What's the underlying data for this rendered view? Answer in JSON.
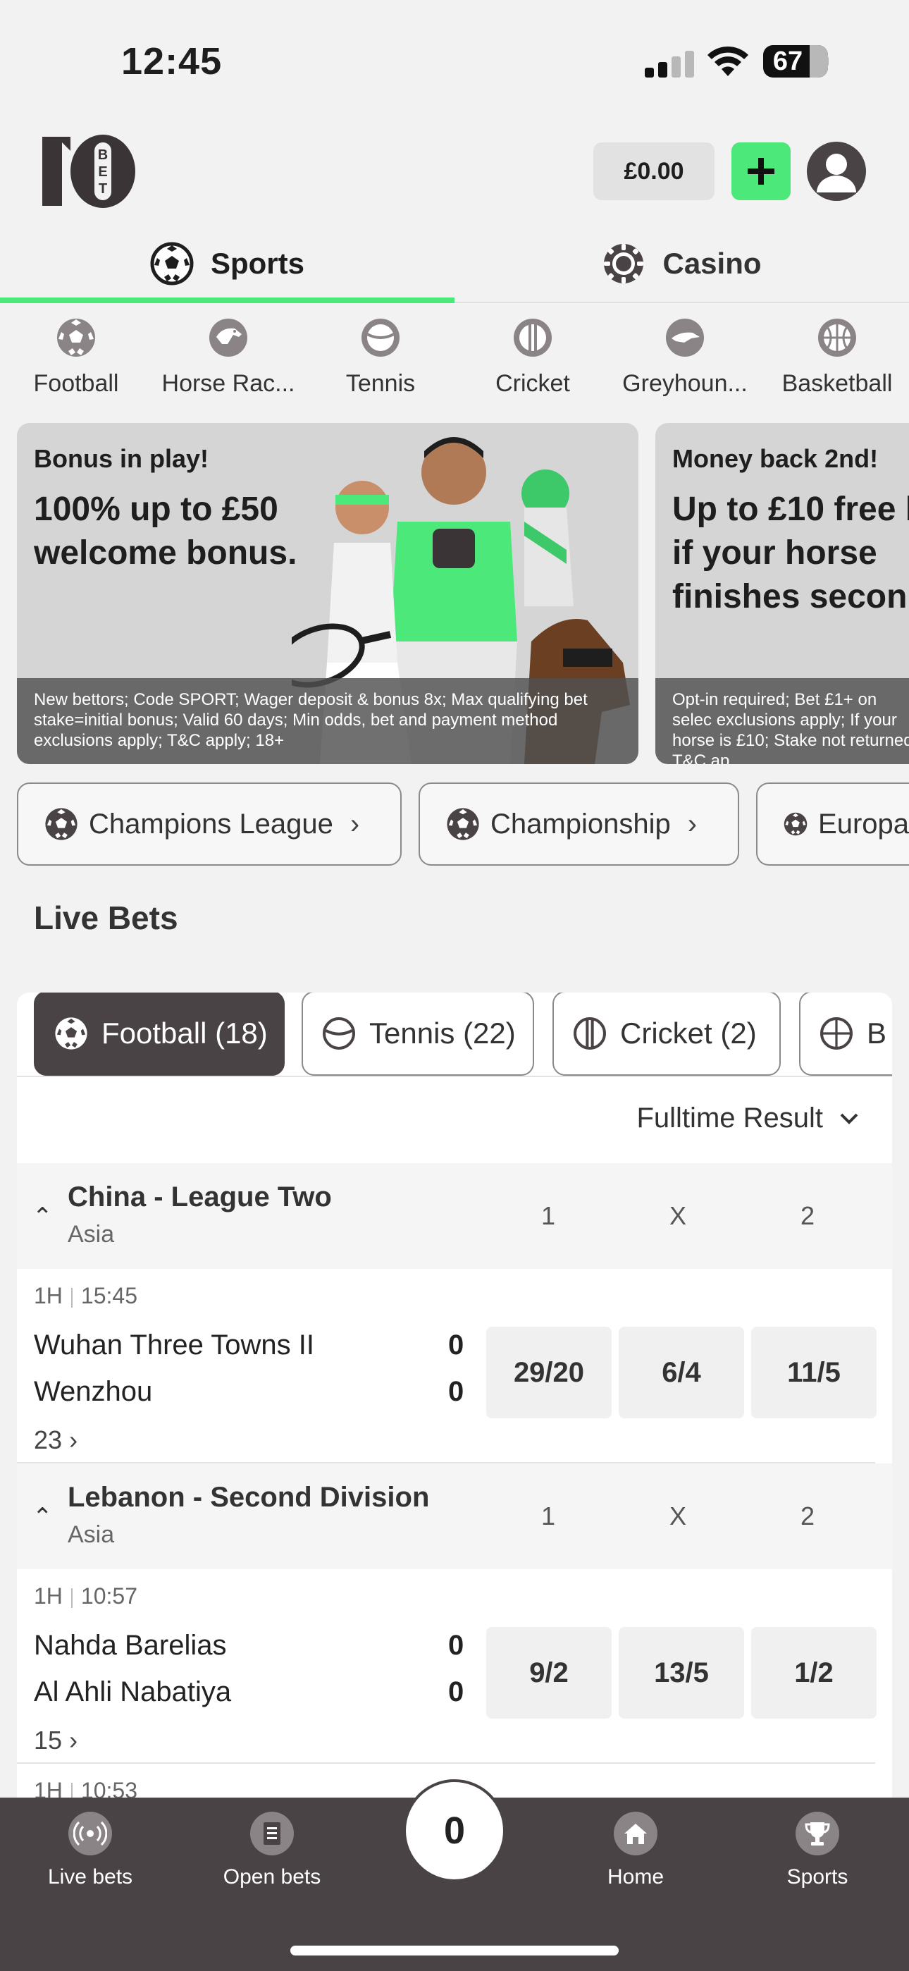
{
  "status_bar": {
    "time": "12:45",
    "battery": "67"
  },
  "header": {
    "balance": "£0.00"
  },
  "top_tabs": [
    {
      "label": "Sports",
      "icon": "football-icon"
    },
    {
      "label": "Casino",
      "icon": "casino-chip-icon"
    }
  ],
  "sports": [
    {
      "label": "Football",
      "icon": "football-icon"
    },
    {
      "label": "Horse Rac...",
      "icon": "horse-racing-icon"
    },
    {
      "label": "Tennis",
      "icon": "tennis-ball-icon"
    },
    {
      "label": "Cricket",
      "icon": "cricket-ball-icon"
    },
    {
      "label": "Greyhoun...",
      "icon": "greyhound-icon"
    },
    {
      "label": "Basketball",
      "icon": "basketball-icon"
    }
  ],
  "promos": [
    {
      "kicker": "Bonus in play!",
      "headline": "100% up to £50\nwelcome bonus.",
      "terms": "New bettors; Code SPORT; Wager deposit & bonus 8x; Max qualifying bet stake=initial bonus; Valid 60 days; Min odds, bet and payment method exclusions apply; T&C apply; 18+"
    },
    {
      "kicker": "Money back 2nd!",
      "headline": "Up to £10 free b\nif your horse\nfinishes secon",
      "terms": "Opt-in required; Bet £1+ on selec exclusions apply; If your horse is £10; Stake not returned; T&C ap"
    }
  ],
  "league_chips": [
    "Champions League",
    "Championship",
    "Europa"
  ],
  "live_bets": {
    "title": "Live Bets",
    "filters": [
      "Football (18)",
      "Tennis (22)",
      "Cricket (2)",
      "B"
    ],
    "market": "Fulltime Result",
    "columns": [
      "1",
      "X",
      "2"
    ],
    "leagues": [
      {
        "name": "China - League Two",
        "region": "Asia",
        "event": {
          "period": "1H",
          "clock": "15:45",
          "home": "Wuhan Three Towns II",
          "away": "Wenzhou",
          "home_score": "0",
          "away_score": "0",
          "odds": [
            "29/20",
            "6/4",
            "11/5"
          ],
          "more": "23"
        }
      },
      {
        "name": "Lebanon - Second Division",
        "region": "Asia",
        "event": {
          "period": "1H",
          "clock": "10:57",
          "home": "Nahda Barelias",
          "away": "Al Ahli Nabatiya",
          "home_score": "0",
          "away_score": "0",
          "odds": [
            "9/2",
            "13/5",
            "1/2"
          ],
          "more": "15"
        }
      }
    ],
    "next_event": {
      "period": "1H",
      "clock": "10:53"
    }
  },
  "bottom_nav": {
    "items": [
      {
        "label": "Live bets",
        "icon": "live-broadcast-icon"
      },
      {
        "label": "Open bets",
        "icon": "receipt-icon"
      },
      {
        "label": "Home",
        "icon": "home-icon"
      },
      {
        "label": "Sports",
        "icon": "trophy-icon"
      }
    ],
    "betslip_count": "0"
  },
  "colors": {
    "accent": "#4ce87a",
    "dark": "#4a4345",
    "background": "#f2f2f2"
  }
}
